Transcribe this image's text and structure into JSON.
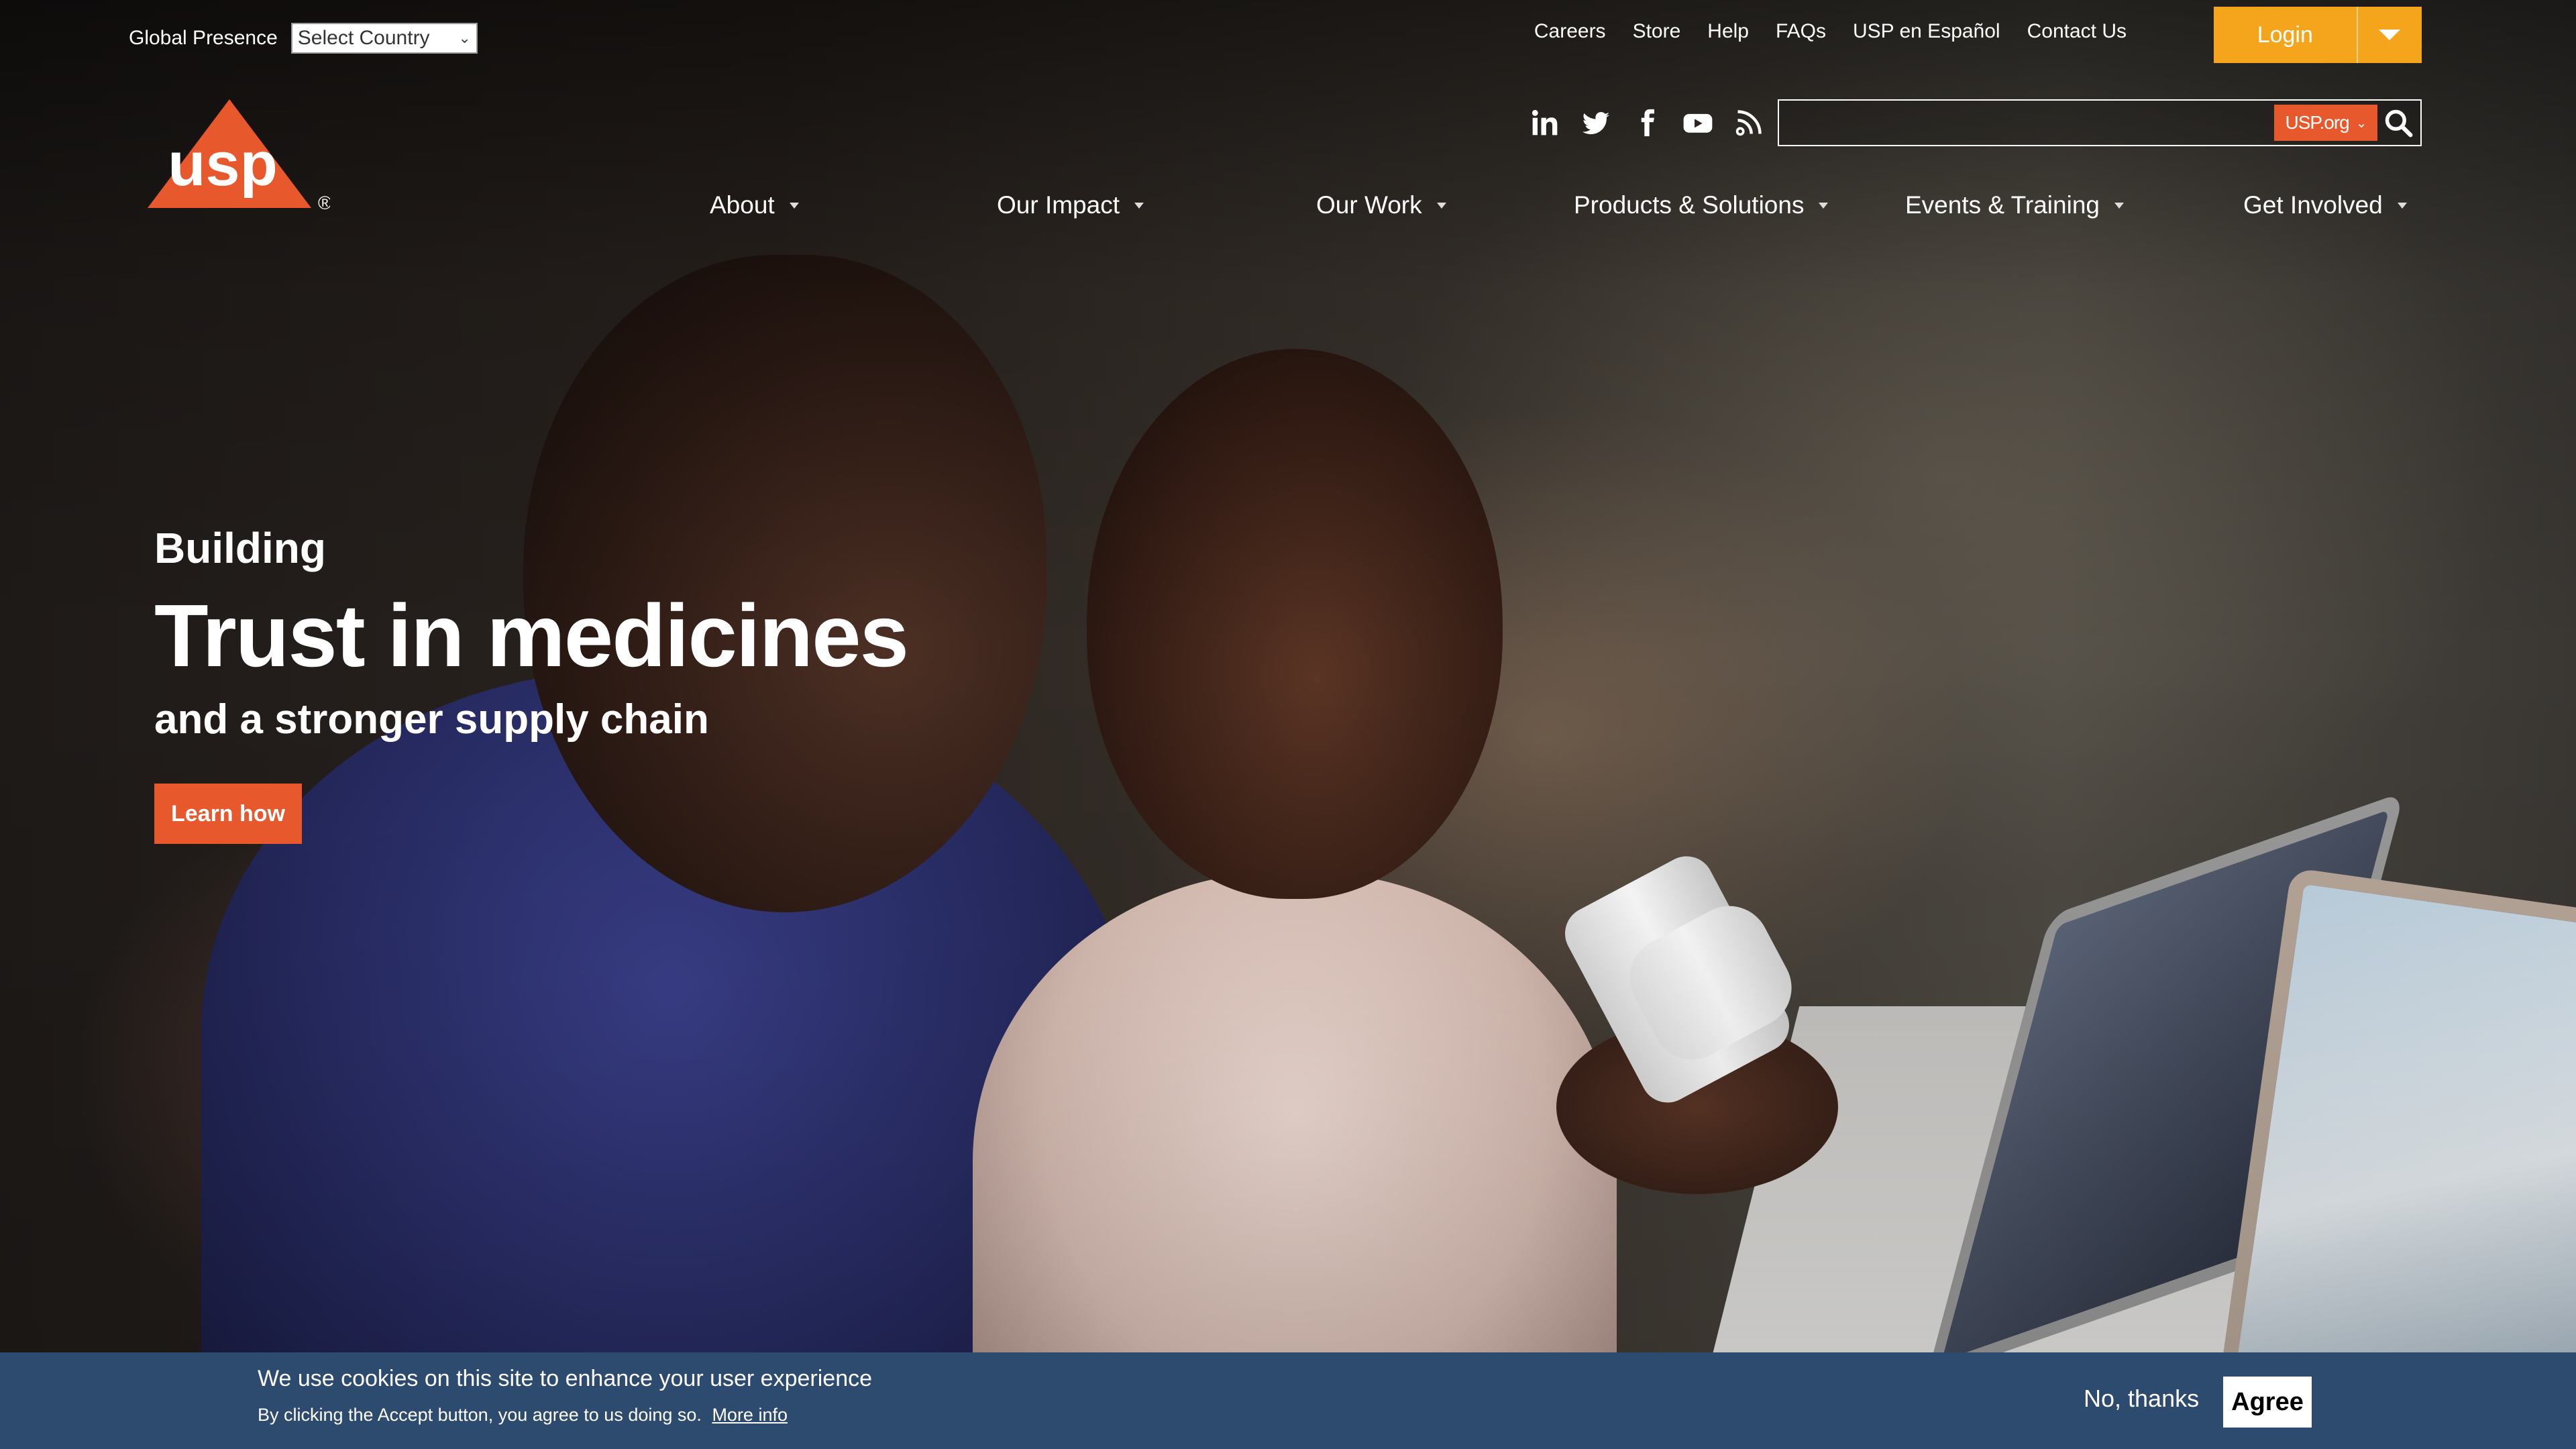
{
  "header": {
    "global_presence_label": "Global Presence",
    "country_select_value": "Select Country",
    "utility_links": [
      "Careers",
      "Store",
      "Help",
      "FAQs",
      "USP en Español",
      "Contact Us"
    ],
    "login_label": "Login",
    "search_scope": "USP.org",
    "search_placeholder": "",
    "social_icons": [
      "linkedin-icon",
      "twitter-icon",
      "facebook-icon",
      "youtube-icon",
      "rss-icon"
    ]
  },
  "brand": {
    "logo_text": "usp",
    "registered_mark": "®",
    "accent_color": "#e8582d"
  },
  "nav": {
    "items": [
      {
        "label": "About"
      },
      {
        "label": "Our Impact"
      },
      {
        "label": "Our Work"
      },
      {
        "label": "Products & Solutions"
      },
      {
        "label": "Events & Training"
      },
      {
        "label": "Get Involved"
      }
    ]
  },
  "hero": {
    "kicker": "Building",
    "headline": "Trust in medicines",
    "subline": "and a stronger supply chain",
    "cta_label": "Learn how"
  },
  "cookie_banner": {
    "title": "We use cookies on this site to enhance your user experience",
    "subtitle": "By clicking the Accept button, you agree to us doing so.",
    "more_info": "More info",
    "decline_label": "No, thanks",
    "agree_label": "Agree"
  }
}
